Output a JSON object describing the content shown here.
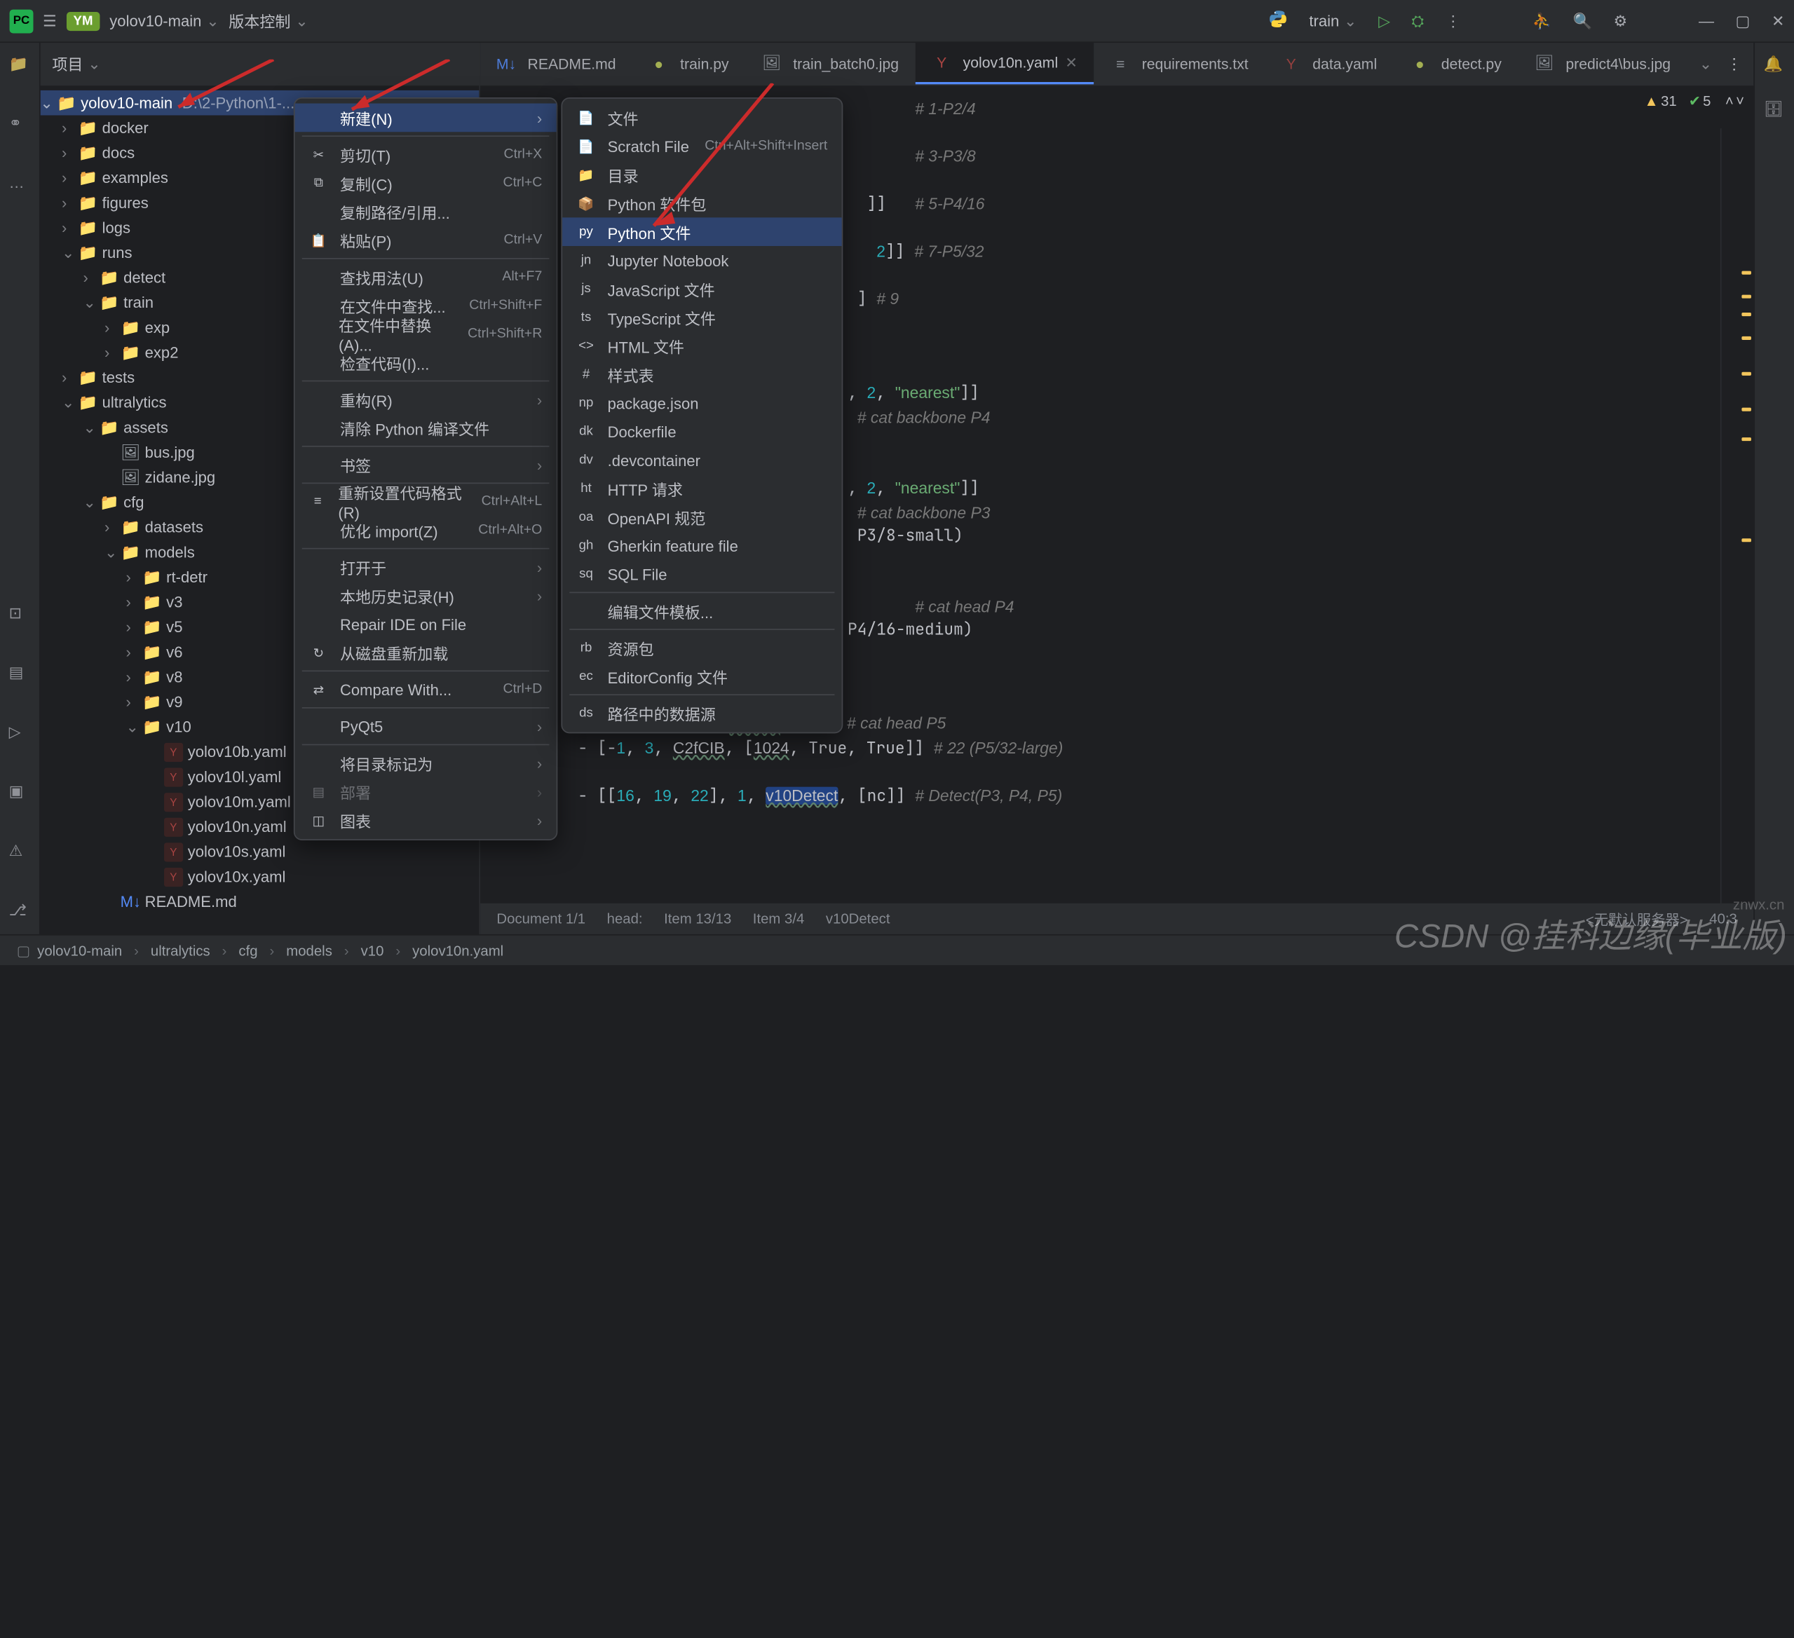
{
  "titlebar": {
    "project_initials": "YM",
    "project_name": "yolov10-main",
    "vcs_label": "版本控制",
    "run_config": "train"
  },
  "project_panel": {
    "title": "项目",
    "root_hint": "D:\\2-Python\\1-..."
  },
  "tree": [
    {
      "d": 0,
      "c": "v",
      "i": "dir",
      "t": "yolov10-main",
      "sel": true
    },
    {
      "d": 1,
      "c": ">",
      "i": "dir",
      "t": "docker"
    },
    {
      "d": 1,
      "c": ">",
      "i": "dir",
      "t": "docs"
    },
    {
      "d": 1,
      "c": ">",
      "i": "dir",
      "t": "examples"
    },
    {
      "d": 1,
      "c": ">",
      "i": "dir",
      "t": "figures"
    },
    {
      "d": 1,
      "c": ">",
      "i": "dir",
      "t": "logs"
    },
    {
      "d": 1,
      "c": "v",
      "i": "dir",
      "t": "runs"
    },
    {
      "d": 2,
      "c": ">",
      "i": "dir",
      "t": "detect"
    },
    {
      "d": 2,
      "c": "v",
      "i": "dir",
      "t": "train"
    },
    {
      "d": 3,
      "c": ">",
      "i": "dir",
      "t": "exp"
    },
    {
      "d": 3,
      "c": ">",
      "i": "dir",
      "t": "exp2"
    },
    {
      "d": 1,
      "c": ">",
      "i": "dir",
      "t": "tests"
    },
    {
      "d": 1,
      "c": "v",
      "i": "dir",
      "t": "ultralytics"
    },
    {
      "d": 2,
      "c": "v",
      "i": "dir",
      "t": "assets"
    },
    {
      "d": 3,
      "c": "",
      "i": "img",
      "t": "bus.jpg"
    },
    {
      "d": 3,
      "c": "",
      "i": "img",
      "t": "zidane.jpg"
    },
    {
      "d": 2,
      "c": "v",
      "i": "dir",
      "t": "cfg"
    },
    {
      "d": 3,
      "c": ">",
      "i": "dir",
      "t": "datasets"
    },
    {
      "d": 3,
      "c": "v",
      "i": "dir",
      "t": "models"
    },
    {
      "d": 4,
      "c": ">",
      "i": "dir",
      "t": "rt-detr"
    },
    {
      "d": 4,
      "c": ">",
      "i": "dir",
      "t": "v3"
    },
    {
      "d": 4,
      "c": ">",
      "i": "dir",
      "t": "v5"
    },
    {
      "d": 4,
      "c": ">",
      "i": "dir",
      "t": "v6"
    },
    {
      "d": 4,
      "c": ">",
      "i": "dir",
      "t": "v8"
    },
    {
      "d": 4,
      "c": ">",
      "i": "dir",
      "t": "v9"
    },
    {
      "d": 4,
      "c": "v",
      "i": "dir",
      "t": "v10"
    },
    {
      "d": 5,
      "c": "",
      "i": "yaml",
      "t": "yolov10b.yaml"
    },
    {
      "d": 5,
      "c": "",
      "i": "yaml",
      "t": "yolov10l.yaml"
    },
    {
      "d": 5,
      "c": "",
      "i": "yaml",
      "t": "yolov10m.yaml"
    },
    {
      "d": 5,
      "c": "",
      "i": "yaml",
      "t": "yolov10n.yaml"
    },
    {
      "d": 5,
      "c": "",
      "i": "yaml",
      "t": "yolov10s.yaml"
    },
    {
      "d": 5,
      "c": "",
      "i": "yaml",
      "t": "yolov10x.yaml"
    },
    {
      "d": 3,
      "c": "",
      "i": "md",
      "t": "README.md"
    }
  ],
  "tabs": [
    {
      "i": "md",
      "t": "README.md"
    },
    {
      "i": "py",
      "t": "train.py"
    },
    {
      "i": "img",
      "t": "train_batch0.jpg"
    },
    {
      "i": "yaml",
      "t": "yolov10n.yaml",
      "active": true,
      "closable": true
    },
    {
      "i": "txt",
      "t": "requirements.txt"
    },
    {
      "i": "yaml",
      "t": "data.yaml"
    },
    {
      "i": "py",
      "t": "detect.py"
    },
    {
      "i": "img",
      "t": "predict4\\bus.jpg"
    }
  ],
  "inspections": {
    "warn": "31",
    "ok": "5"
  },
  "context_menu1": [
    {
      "t": "新建(N)",
      "hl": true,
      "sub": true
    },
    {
      "sep": true
    },
    {
      "t": "剪切(T)",
      "kb": "Ctrl+X",
      "icon": "✂"
    },
    {
      "t": "复制(C)",
      "kb": "Ctrl+C",
      "icon": "⧉"
    },
    {
      "t": "复制路径/引用..."
    },
    {
      "t": "粘贴(P)",
      "kb": "Ctrl+V",
      "icon": "📋"
    },
    {
      "sep": true
    },
    {
      "t": "查找用法(U)",
      "kb": "Alt+F7"
    },
    {
      "t": "在文件中查找...",
      "kb": "Ctrl+Shift+F"
    },
    {
      "t": "在文件中替换(A)...",
      "kb": "Ctrl+Shift+R"
    },
    {
      "t": "检查代码(I)..."
    },
    {
      "sep": true
    },
    {
      "t": "重构(R)",
      "sub": true
    },
    {
      "t": "清除 Python 编译文件"
    },
    {
      "sep": true
    },
    {
      "t": "书签",
      "sub": true
    },
    {
      "sep": true
    },
    {
      "t": "重新设置代码格式(R)",
      "kb": "Ctrl+Alt+L",
      "icon": "≡"
    },
    {
      "t": "优化 import(Z)",
      "kb": "Ctrl+Alt+O"
    },
    {
      "sep": true
    },
    {
      "t": "打开于",
      "sub": true
    },
    {
      "t": "本地历史记录(H)",
      "sub": true
    },
    {
      "t": "Repair IDE on File"
    },
    {
      "t": "从磁盘重新加载",
      "icon": "↻"
    },
    {
      "sep": true
    },
    {
      "t": "Compare With...",
      "kb": "Ctrl+D",
      "icon": "⇄"
    },
    {
      "sep": true
    },
    {
      "t": "PyQt5",
      "sub": true
    },
    {
      "sep": true
    },
    {
      "t": "将目录标记为",
      "sub": true
    },
    {
      "t": "部署",
      "icon": "▤",
      "disabled": true,
      "sub": true
    },
    {
      "t": "图表",
      "icon": "◫",
      "sub": true
    }
  ],
  "context_menu2": [
    {
      "t": "文件",
      "icon": "📄"
    },
    {
      "t": "Scratch File",
      "kb": "Ctrl+Alt+Shift+Insert",
      "icon": "📄"
    },
    {
      "t": "目录",
      "icon": "📁"
    },
    {
      "t": "Python 软件包",
      "icon": "📦"
    },
    {
      "t": "Python 文件",
      "icon": "py",
      "hl": true
    },
    {
      "t": "Jupyter Notebook",
      "icon": "jn"
    },
    {
      "t": "JavaScript 文件",
      "icon": "js"
    },
    {
      "t": "TypeScript 文件",
      "icon": "ts"
    },
    {
      "t": "HTML 文件",
      "icon": "<>"
    },
    {
      "t": "样式表",
      "icon": "#"
    },
    {
      "t": "package.json",
      "icon": "np"
    },
    {
      "t": "Dockerfile",
      "icon": "dk"
    },
    {
      "t": ".devcontainer",
      "icon": "dv"
    },
    {
      "t": "HTTP 请求",
      "icon": "ht"
    },
    {
      "t": "OpenAPI 规范",
      "icon": "oa"
    },
    {
      "t": "Gherkin feature file",
      "icon": "gh"
    },
    {
      "t": "SQL File",
      "icon": "sq"
    },
    {
      "sep": true
    },
    {
      "t": "编辑文件模板..."
    },
    {
      "sep": true
    },
    {
      "t": "资源包",
      "icon": "rb"
    },
    {
      "t": "EditorConfig 文件",
      "icon": "ec"
    },
    {
      "sep": true
    },
    {
      "t": "路径中的数据源",
      "icon": "ds"
    }
  ],
  "status": {
    "doc": "Document 1/1",
    "head": "head:",
    "item1": "Item 13/13",
    "item2": "Item 3/4",
    "detect": "v10Detect",
    "server": "<无默认服务器>",
    "col": "40:3"
  },
  "crumbs": [
    "yolov10-main",
    "ultralytics",
    "cfg",
    "models",
    "v10",
    "yolov10n.yaml"
  ],
  "watermark": "CSDN @挂科边缘(毕业版)",
  "watermark2": "znwx.cn"
}
